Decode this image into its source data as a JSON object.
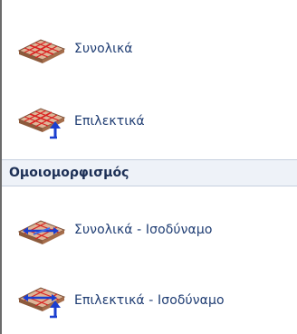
{
  "group1": {
    "items": [
      {
        "label": "Συνολικά",
        "icon": "distributed-load-plate-icon"
      },
      {
        "label": "Επιλεκτικά",
        "icon": "selective-load-plate-icon"
      }
    ]
  },
  "section": {
    "title": "Ομοιομορφισμός"
  },
  "group2": {
    "items": [
      {
        "label": "Συνολικά - Ισοδύναμο",
        "icon": "uniform-equivalent-plate-icon"
      },
      {
        "label": "Επιλεκτικά - Ισοδύναμο",
        "icon": "selective-equivalent-plate-icon"
      }
    ]
  },
  "colors": {
    "text": "#1f3d73",
    "header_bg": "#eef2f8",
    "slab": "#d9aa8a",
    "red_lines": "#d92020",
    "blue_arrow": "#1a3fd0"
  }
}
